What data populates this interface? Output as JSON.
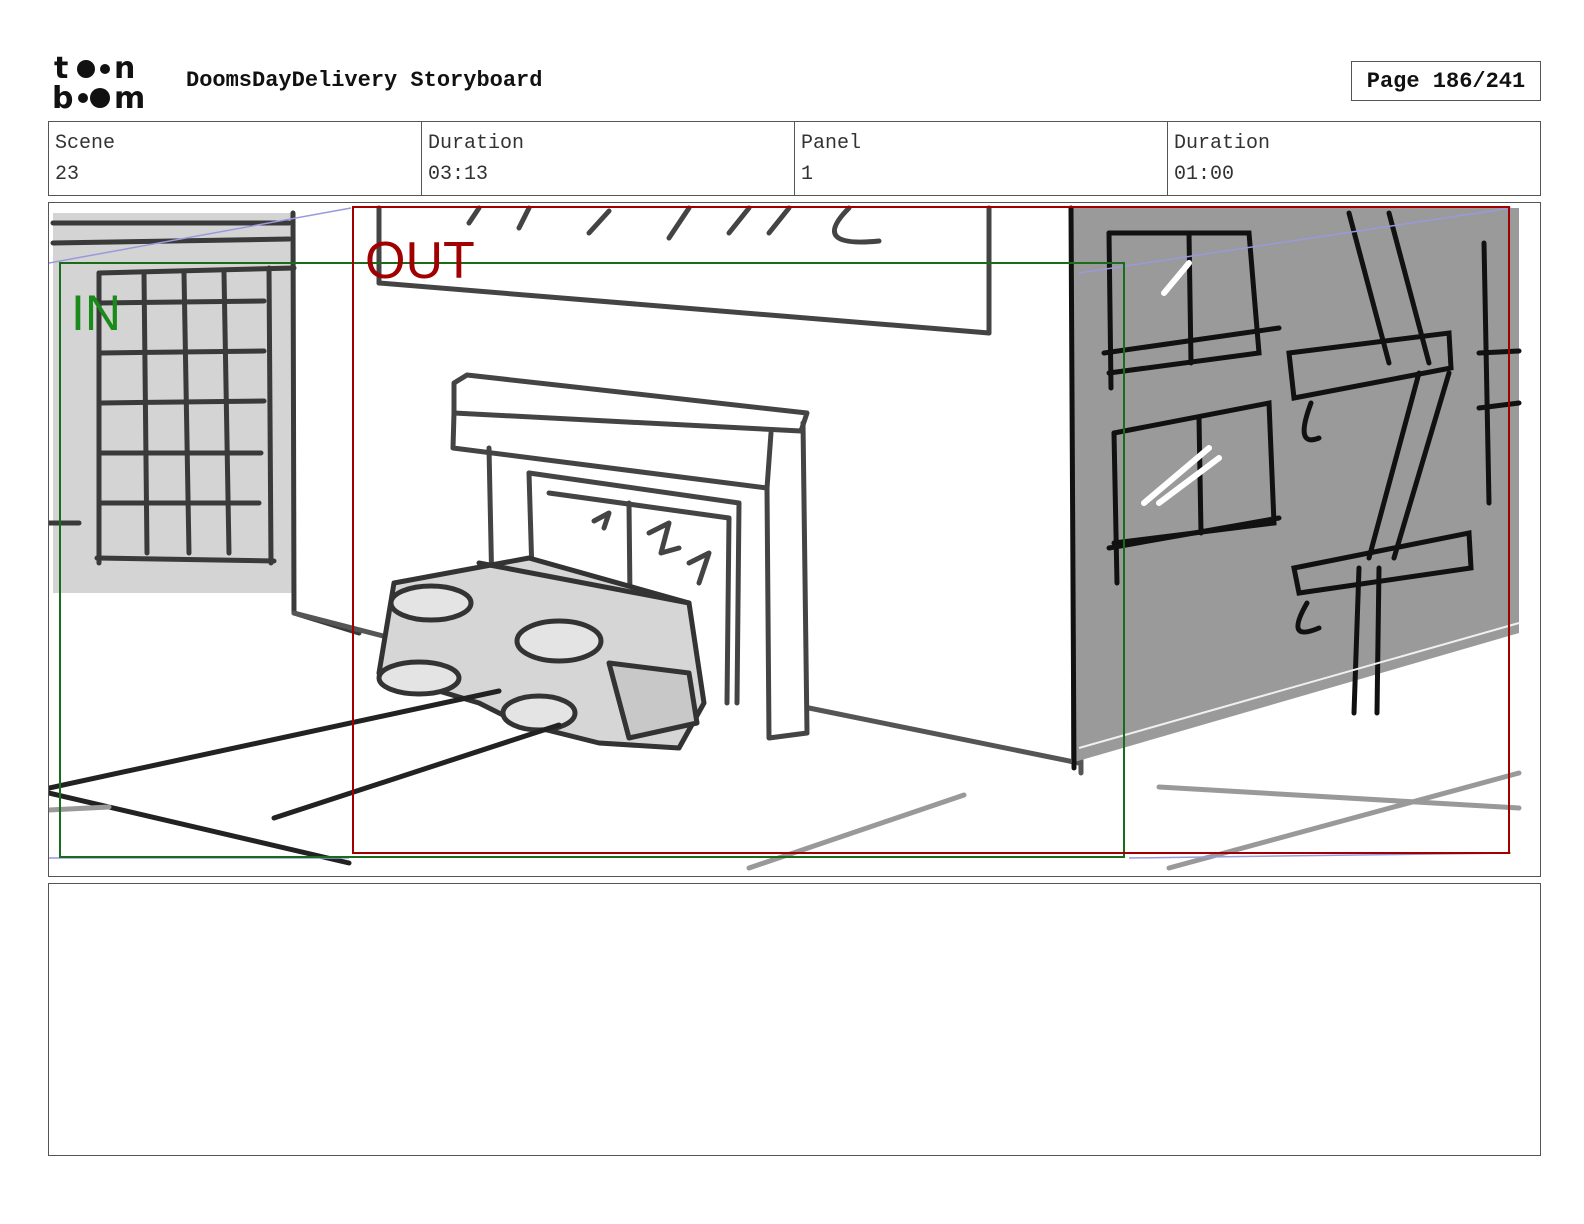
{
  "header": {
    "logo_text": "toon boom",
    "title": "DoomsDayDelivery Storyboard",
    "page": "Page 186/241"
  },
  "info": {
    "scene_label": "Scene",
    "scene_value": "23",
    "scene_duration_label": "Duration",
    "scene_duration_value": "03:13",
    "panel_label": "Panel",
    "panel_value": "1",
    "panel_duration_label": "Duration",
    "panel_duration_value": "01:00"
  },
  "panel": {
    "in_label": "IN",
    "out_label": "OUT",
    "in_color": "#1a8a1a",
    "out_color": "#a00000",
    "building_shade": "#9a9a9a"
  },
  "caption": {
    "text": ""
  }
}
